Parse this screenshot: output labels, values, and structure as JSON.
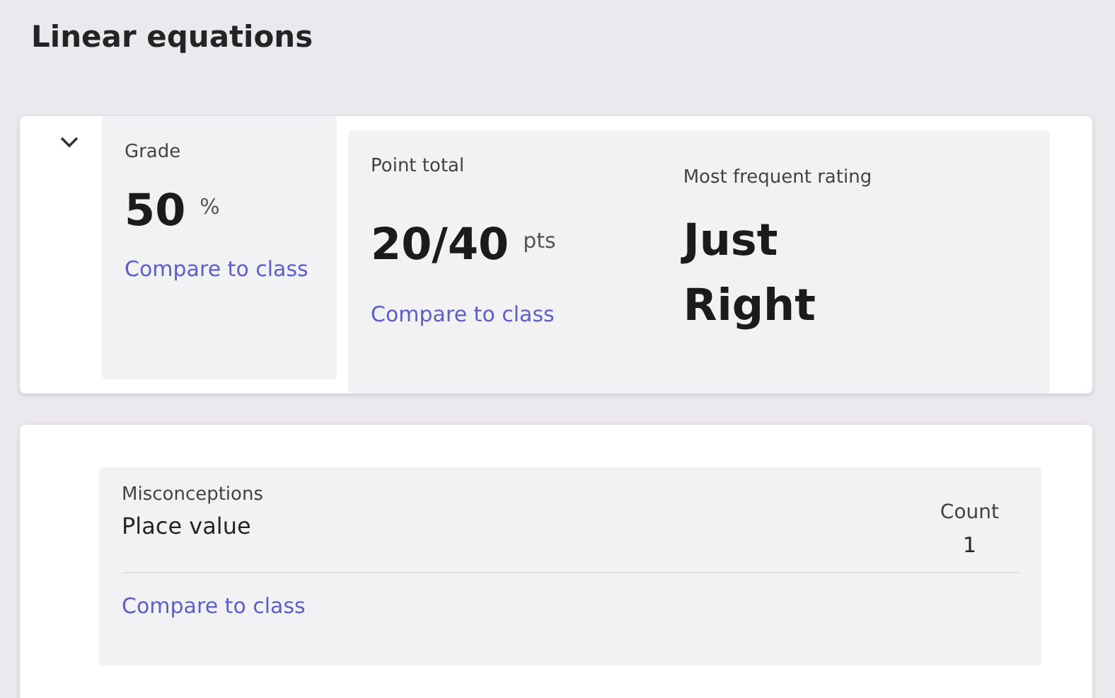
{
  "title": "Linear equations",
  "summary": {
    "expanded": true,
    "grade": {
      "label": "Grade",
      "value": "50",
      "unit": "%",
      "link": "Compare to class"
    },
    "points": {
      "label": "Point total",
      "value": "20/40",
      "unit": "pts",
      "link": "Compare to class"
    },
    "rating": {
      "label": "Most frequent rating",
      "value": "Just Right"
    }
  },
  "misconceptions": {
    "columns": [
      "Misconceptions",
      "Count"
    ],
    "rows": [
      {
        "name": "Place value",
        "count": "1"
      }
    ],
    "link": "Compare to class"
  }
}
